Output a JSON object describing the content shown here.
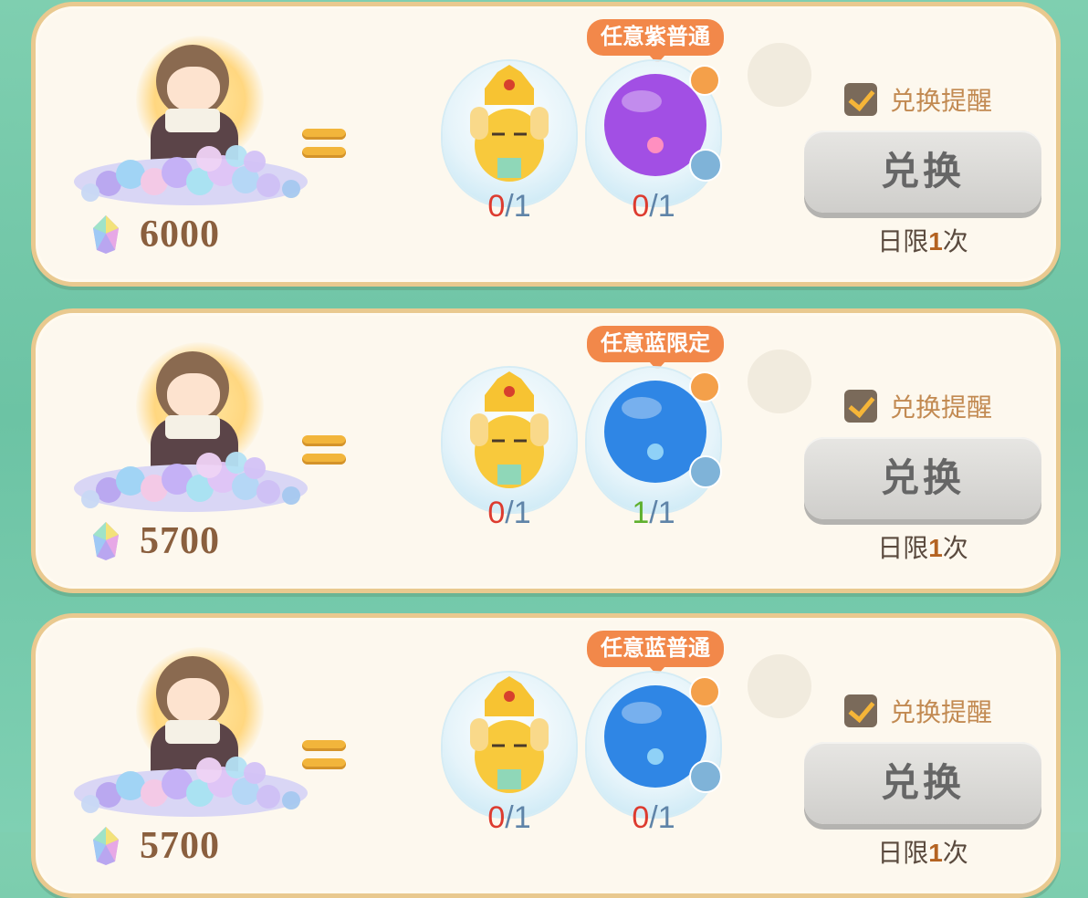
{
  "rows": [
    {
      "cost": "6000",
      "tag": "任意紫普通",
      "item1_count": {
        "have": "0",
        "need": "/1"
      },
      "item2_count": {
        "have": "0",
        "need": "/1"
      },
      "item2_color": "#a24fe4",
      "item2_state": "red",
      "remind_label": "兑换提醒",
      "button_label": "兑换",
      "limit": {
        "prefix": "日限",
        "num": "1",
        "suffix": "次"
      }
    },
    {
      "cost": "5700",
      "tag": "任意蓝限定",
      "item1_count": {
        "have": "0",
        "need": "/1"
      },
      "item2_count": {
        "have": "1",
        "need": "/1"
      },
      "item2_color": "#2f86e5",
      "item2_state": "green",
      "remind_label": "兑换提醒",
      "button_label": "兑换",
      "limit": {
        "prefix": "日限",
        "num": "1",
        "suffix": "次"
      }
    },
    {
      "cost": "5700",
      "tag": "任意蓝普通",
      "item1_count": {
        "have": "0",
        "need": "/1"
      },
      "item2_count": {
        "have": "0",
        "need": "/1"
      },
      "item2_color": "#2f86e5",
      "item2_state": "red",
      "remind_label": "兑换提醒",
      "button_label": "兑换",
      "limit": {
        "prefix": "日限",
        "num": "1",
        "suffix": "次"
      }
    }
  ],
  "colors": {
    "background": "#7fcfb0",
    "card": "#fdf8ee",
    "card_border": "#e9c98f",
    "tag": "#f2884a",
    "equals": "#f2b53b",
    "count_red": "#dd3b2f",
    "count_green": "#5fb02e"
  },
  "icons": [
    "rainbow-gem-icon",
    "equals-icon",
    "crown-character-icon",
    "orb-icon",
    "magnifier-icon",
    "hot-badge-icon",
    "checkbox-checked-icon"
  ]
}
